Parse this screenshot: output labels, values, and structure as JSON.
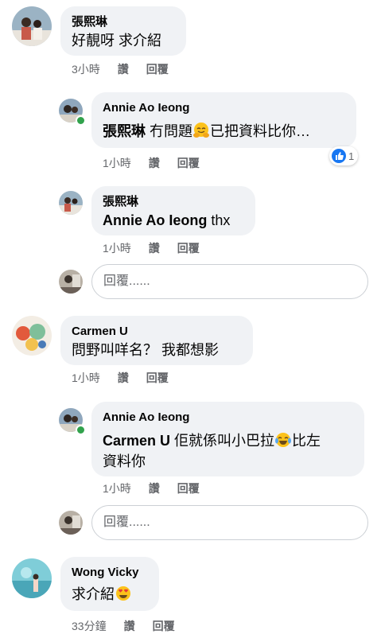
{
  "comments": [
    {
      "author": "張熙琳",
      "text": "好靚呀 求介紹",
      "time": "3小時",
      "like_label": "讚",
      "reply_label": "回覆",
      "replies": [
        {
          "author": "Annie Ao Ieong",
          "mention": "張熙琳",
          "text_before_emoji": "冇問題",
          "emoji": "hugging-face-icon",
          "text_after_emoji": "已把資料比你…",
          "time": "1小時",
          "like_label": "讚",
          "reply_label": "回覆",
          "reaction_count": "1"
        },
        {
          "author": "張熙琳",
          "mention": "Annie Ao Ieong",
          "text": "thx",
          "time": "1小時",
          "like_label": "讚",
          "reply_label": "回覆"
        }
      ],
      "reply_placeholder": "回覆......"
    },
    {
      "author": "Carmen U",
      "text": "問野叫咩名？ 我都想影",
      "time": "1小時",
      "like_label": "讚",
      "reply_label": "回覆",
      "replies": [
        {
          "author": "Annie Ao Ieong",
          "mention": "Carmen U",
          "text_before_emoji": "佢就係叫小巴拉",
          "emoji": "tears-of-joy-icon",
          "text_after_emoji": "比左",
          "text_line2": "資料你",
          "time": "1小時",
          "like_label": "讚",
          "reply_label": "回覆"
        }
      ],
      "reply_placeholder": "回覆......"
    },
    {
      "author": "Wong Vicky",
      "text_before_emoji": "求介紹",
      "emoji": "heart-eyes-icon",
      "time": "33分鐘",
      "like_label": "讚",
      "reply_label": "回覆"
    }
  ],
  "colors": {
    "bubble": "#f0f2f5",
    "meta_text": "#65676b",
    "like_blue": "#1877f2",
    "online_green": "#31a24c"
  }
}
